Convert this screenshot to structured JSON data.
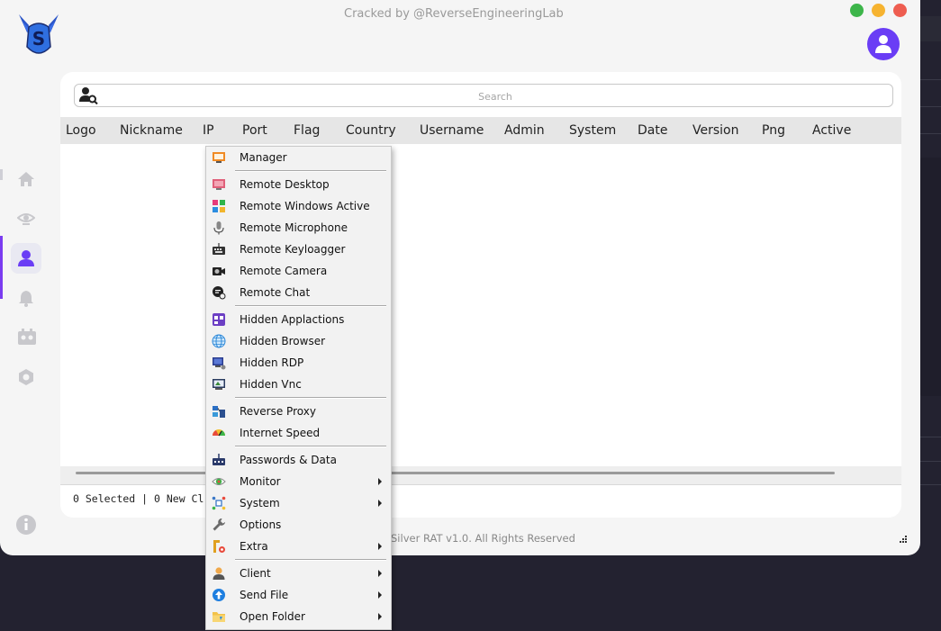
{
  "window": {
    "title": "Cracked by @ReverseEngineeringLab",
    "footer": "Silver RAT v1.0. All Rights Reserved",
    "controls": [
      {
        "name": "minimize",
        "color": "#3db54a"
      },
      {
        "name": "maximize",
        "color": "#f6b330"
      },
      {
        "name": "close",
        "color": "#ee5d50"
      }
    ]
  },
  "colors": {
    "accent": "#6a3df5",
    "sidebar_icon": "#c8c8cc",
    "logo_blue": "#2f6fe0"
  },
  "search": {
    "placeholder": "Search",
    "value": ""
  },
  "table": {
    "columns": [
      "Logo",
      "Nickname",
      "IP",
      "Port",
      "Flag",
      "Country",
      "Username",
      "Admin",
      "System",
      "Date",
      "Version",
      "Png",
      "Active"
    ],
    "rows": []
  },
  "status": {
    "text": "0 Selected | 0 New Cl"
  },
  "sidebar": {
    "items": [
      {
        "icon": "home-icon"
      },
      {
        "icon": "eye-icon"
      },
      {
        "icon": "user-icon",
        "active": true
      },
      {
        "icon": "bell-icon"
      },
      {
        "icon": "plugin-icon"
      },
      {
        "icon": "settings-icon"
      }
    ],
    "info_icon": "info-icon"
  },
  "context_menu": {
    "items": [
      {
        "label": "Manager",
        "icon": "manager-icon",
        "submenu": false
      },
      {
        "label": "Remote Desktop",
        "icon": "monitor-icon",
        "submenu": false
      },
      {
        "label": "Remote Windows Active",
        "icon": "windows-icon",
        "submenu": false
      },
      {
        "label": "Remote Microphone",
        "icon": "microphone-icon",
        "submenu": false
      },
      {
        "label": "Remote Keyloagger",
        "icon": "keyboard-icon",
        "submenu": false
      },
      {
        "label": "Remote Camera",
        "icon": "camera-icon",
        "submenu": false
      },
      {
        "label": "Remote Chat",
        "icon": "chat-icon",
        "submenu": false
      },
      {
        "label": "Hidden Applactions",
        "icon": "apps-icon",
        "submenu": false
      },
      {
        "label": "Hidden Browser",
        "icon": "globe-icon",
        "submenu": false
      },
      {
        "label": "Hidden RDP",
        "icon": "rdp-icon",
        "submenu": false
      },
      {
        "label": "Hidden Vnc",
        "icon": "vnc-icon",
        "submenu": false
      },
      {
        "label": "Reverse Proxy",
        "icon": "proxy-icon",
        "submenu": false
      },
      {
        "label": "Internet Speed",
        "icon": "speed-icon",
        "submenu": false
      },
      {
        "label": "Passwords & Data",
        "icon": "passwords-icon",
        "submenu": false
      },
      {
        "label": "Monitor",
        "icon": "eye-monitor-icon",
        "submenu": true
      },
      {
        "label": "System",
        "icon": "system-icon",
        "submenu": true
      },
      {
        "label": "Options",
        "icon": "wrench-icon",
        "submenu": false
      },
      {
        "label": "Extra",
        "icon": "extra-icon",
        "submenu": true
      },
      {
        "label": "Client",
        "icon": "client-icon",
        "submenu": true
      },
      {
        "label": "Send File",
        "icon": "upload-icon",
        "submenu": true
      },
      {
        "label": "Open Folder",
        "icon": "folder-icon",
        "submenu": true
      }
    ]
  }
}
